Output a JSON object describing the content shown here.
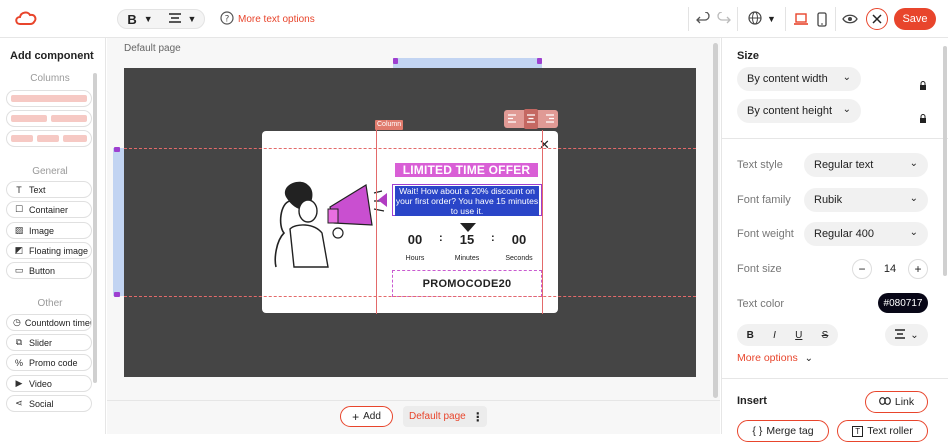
{
  "topbar": {
    "bold_label": "B",
    "more_text_options": "More text options",
    "save_label": "Save"
  },
  "left_panel": {
    "title": "Add component",
    "columns_heading": "Columns",
    "general_heading": "General",
    "general_items": [
      "Text",
      "Container",
      "Image",
      "Floating image",
      "Button"
    ],
    "other_heading": "Other",
    "other_items": [
      "Countdown timer",
      "Slider",
      "Promo code",
      "Video",
      "Social"
    ]
  },
  "canvas": {
    "page_label": "Default page",
    "column_tag": "Column",
    "popup": {
      "headline": "LIMITED TIME OFFER",
      "body_text": "Wait! How about a 20% discount on your first order? You have 15 minutes to use it.",
      "countdown": [
        {
          "value": "00",
          "label": "Hours"
        },
        {
          "value": "15",
          "label": "Minutes"
        },
        {
          "value": "00",
          "label": "Seconds"
        }
      ],
      "separator": ":",
      "promo_code": "PROMOCODE20",
      "close_symbol": "✕"
    },
    "add_label": "Add",
    "page_selector": "Default page"
  },
  "right_panel": {
    "size_heading": "Size",
    "width_select": "By content width",
    "height_select": "By content height",
    "text_style_label": "Text style",
    "text_style_value": "Regular text",
    "font_family_label": "Font family",
    "font_family_value": "Rubik",
    "font_weight_label": "Font weight",
    "font_weight_value": "Regular 400",
    "font_size_label": "Font size",
    "font_size_value": "14",
    "text_color_label": "Text color",
    "text_color_value": "#080717",
    "format_buttons": [
      "B",
      "I",
      "U",
      "S"
    ],
    "more_options": "More options",
    "insert_heading": "Insert",
    "link_label": "Link",
    "merge_tag_label": "Merge tag",
    "text_roller_label": "Text roller"
  },
  "colors": {
    "accent": "#e8452c",
    "popup_purple": "#d95fd6",
    "selection_blue": "#2a45c8",
    "canvas_dark": "#454545"
  }
}
